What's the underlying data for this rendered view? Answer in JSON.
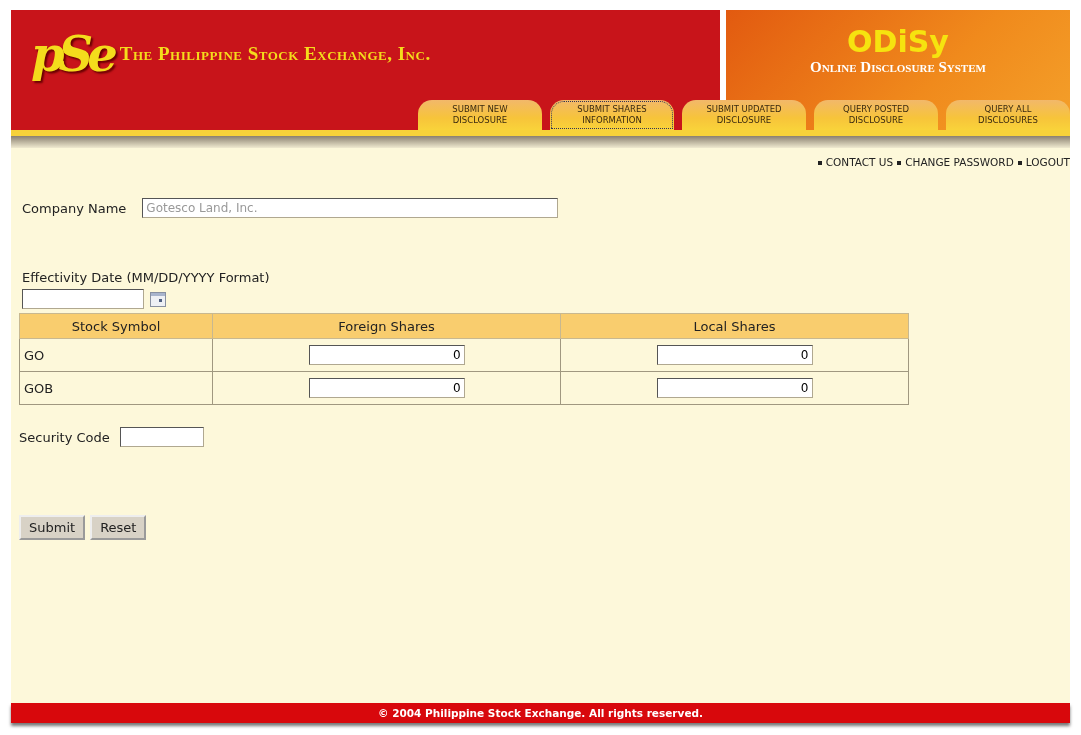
{
  "header": {
    "logo": "pSe",
    "title": "The Philippine Stock Exchange, Inc.",
    "system_name": "ODiSy",
    "system_subtitle": "Online Disclosure System"
  },
  "tabs": [
    {
      "label": "SUBMIT NEW DISCLOSURE",
      "selected": false
    },
    {
      "label": "SUBMIT SHARES INFORMATION",
      "selected": true
    },
    {
      "label": "SUBMIT UPDATED DISCLOSURE",
      "selected": false
    },
    {
      "label": "QUERY POSTED DISCLOSURE",
      "selected": false
    },
    {
      "label": "QUERY ALL DISCLOSURES",
      "selected": false
    }
  ],
  "top_links": [
    "CONTACT US",
    "CHANGE PASSWORD",
    "LOGOUT"
  ],
  "form": {
    "company_label": "Company Name",
    "company_value": "Gotesco Land, Inc.",
    "company_disabled": true,
    "date_label": "Effectivity Date (MM/DD/YYYY Format)",
    "table": {
      "columns": [
        "Stock Symbol",
        "Foreign Shares",
        "Local Shares"
      ],
      "rows": [
        {
          "symbol": "GO",
          "foreign": "0",
          "local": "0"
        },
        {
          "symbol": "GOB",
          "foreign": "0",
          "local": "0"
        }
      ]
    },
    "security_label": "Security Code",
    "buttons": [
      "Submit",
      "Reset"
    ]
  },
  "footer": "© 2004 Philippine Stock Exchange. All rights reserved."
}
